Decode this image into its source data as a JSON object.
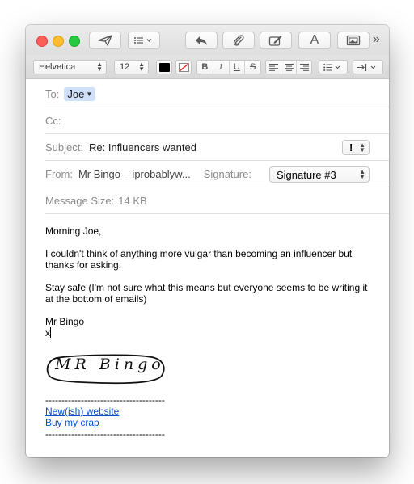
{
  "toolbar": {
    "send_icon": "paper-plane-icon",
    "header_fields_icon": "list-icon",
    "reply_icon": "reply-arrow-icon",
    "attach_icon": "paperclip-icon",
    "markup_icon": "markup-icon",
    "format_label": "A",
    "photo_icon": "photo-browser-icon",
    "overflow_label": "»"
  },
  "format_bar": {
    "font_family": "Helvetica",
    "font_size": "12",
    "bold": "B",
    "italic": "I",
    "underline": "U",
    "strike": "S"
  },
  "header": {
    "to_label": "To:",
    "to_recipient": "Joe",
    "cc_label": "Cc:",
    "subject_label": "Subject:",
    "subject_value": "Re: Influencers wanted",
    "priority_label": "!",
    "from_label": "From:",
    "from_value": "Mr Bingo – iprobablyw...",
    "signature_label": "Signature:",
    "signature_value": "Signature #3",
    "size_label": "Message Size:",
    "size_value": "14 KB"
  },
  "message": {
    "greeting": "Morning Joe,",
    "line1": "I couldn't think of anything more vulgar than becoming an influencer but",
    "line2": "thanks for asking.",
    "line3": "Stay safe (I'm not sure what this means but everyone seems to be writing it",
    "line4": "at the bottom of emails)",
    "sign_name": "Mr Bingo",
    "sign_x": "x",
    "logo_text": "MR Bingo",
    "divider_top": "-------------------------------------",
    "link1": "New(ish) website",
    "link2": "Buy my crap",
    "divider_bottom": "-------------------------------------"
  },
  "colors": {
    "close": "#fc5f57",
    "minimize": "#fdbc2e",
    "zoom": "#28c840",
    "recipient_token": "#cfe0f8",
    "link": "#0a4fd0"
  }
}
